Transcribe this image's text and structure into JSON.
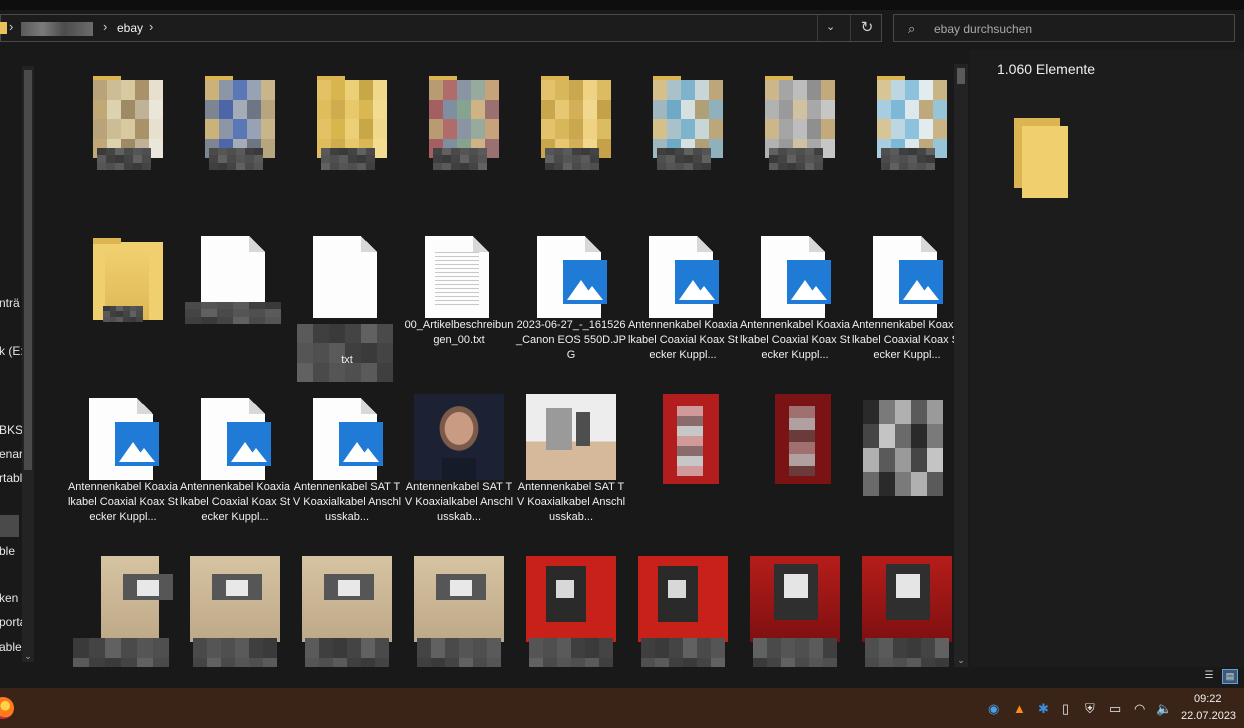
{
  "address": {
    "crumbs": [
      "ebay"
    ],
    "chevron": "›",
    "dropdown": "⌄",
    "refresh": "↻"
  },
  "search": {
    "placeholder": "ebay durchsuchen"
  },
  "nav": {
    "items": [
      "nträ",
      "k (E:",
      "BKS",
      "enar",
      "rtabl",
      "ble",
      "ken",
      "porta",
      "able"
    ],
    "scroll_down": "⌄"
  },
  "files": [
    {
      "type": "folder-blur",
      "palette": [
        "#b9a37a",
        "#cdbd94",
        "#d9c9a0",
        "#a9926a",
        "#e7e0cf",
        "#c2a777",
        "#ddd2b0",
        "#9f8a66",
        "#bfb296",
        "#ebe6da"
      ]
    },
    {
      "type": "folder-blur",
      "palette": [
        "#cbb27a",
        "#8c96a6",
        "#5a78b6",
        "#97a2b4",
        "#c9b58a",
        "#7d8592",
        "#4c66a8",
        "#a4acb8",
        "#6e7686",
        "#b6a57e"
      ]
    },
    {
      "type": "folder-blur",
      "palette": [
        "#e3c266",
        "#d7b64e",
        "#ecd078",
        "#c8a748",
        "#f0d88a",
        "#dfbd5c",
        "#cfad4e",
        "#e8c86a",
        "#d9b854",
        "#f2dc90"
      ]
    },
    {
      "type": "folder-blur",
      "palette": [
        "#b89a73",
        "#b06b6b",
        "#8a94a2",
        "#97aa9e",
        "#c6a37a",
        "#a46060",
        "#7f8ea0",
        "#86a38f",
        "#d0b384",
        "#9b7070"
      ]
    },
    {
      "type": "folder-blur",
      "palette": [
        "#e2c36c",
        "#d8b65a",
        "#caa850",
        "#efd382",
        "#dcbc62",
        "#c9a64c",
        "#e6c872",
        "#d3b058",
        "#f0d88e",
        "#c5a24a"
      ]
    },
    {
      "type": "folder-blur",
      "palette": [
        "#d5c08a",
        "#a9c2c9",
        "#7fb3cc",
        "#c8d6d8",
        "#bba77a",
        "#9fb8c0",
        "#6ea9c8",
        "#d7e0e0",
        "#b0a078",
        "#8fb0bd"
      ]
    },
    {
      "type": "folder-blur",
      "palette": [
        "#cdb68a",
        "#a5a5a5",
        "#bdbdbd",
        "#8f8f8f",
        "#c3aa7a",
        "#b2b2b2",
        "#9a9a9a",
        "#d0c2a0",
        "#a8a8a8",
        "#c6c6c6"
      ]
    },
    {
      "type": "folder-blur",
      "palette": [
        "#d8c596",
        "#bcd6e2",
        "#8cc2dc",
        "#e2ecef",
        "#c9b486",
        "#a8cde0",
        "#7db8d6",
        "#dde8ec",
        "#bfa97c",
        "#98c4d8"
      ]
    },
    {
      "type": "folder-plain"
    },
    {
      "type": "doc-blank"
    },
    {
      "type": "doc-blank",
      "tail": "txt"
    },
    {
      "type": "txt",
      "name": "00_Artikelbeschreibungen_00.txt"
    },
    {
      "type": "image",
      "name": "2023-06-27_-_161526_Canon EOS 550D.JPG"
    },
    {
      "type": "image",
      "name": "Antennenkabel Koaxialkabel Coaxial Koax Stecker Kuppl..."
    },
    {
      "type": "image",
      "name": "Antennenkabel Koaxialkabel Coaxial Koax Stecker Kuppl..."
    },
    {
      "type": "image",
      "name": "Antennenkabel Koaxialkabel Coaxial Koax Stecker Kuppl..."
    },
    {
      "type": "image",
      "name": "Antennenkabel Koaxialkabel Coaxial Koax Stecker Kuppl..."
    },
    {
      "type": "image",
      "name": "Antennenkabel Koaxialkabel Coaxial Koax Stecker Kuppl..."
    },
    {
      "type": "image",
      "name": "Antennenkabel SAT TV Koaxialkabel Anschlusskab..."
    },
    {
      "type": "photo-face",
      "name": "Antennenkabel SAT TV Koaxialkabel Anschlusskab..."
    },
    {
      "type": "photo-kitchen",
      "name": "Antennenkabel SAT TV Koaxialkabel Anschlusskab..."
    },
    {
      "type": "photo-redblur"
    },
    {
      "type": "photo-darkred"
    },
    {
      "type": "photo-grayblur"
    },
    {
      "type": "watch-beige-tall"
    },
    {
      "type": "watch-beige"
    },
    {
      "type": "watch-beige"
    },
    {
      "type": "watch-beige"
    },
    {
      "type": "watch-red"
    },
    {
      "type": "watch-red"
    },
    {
      "type": "watch-black-red"
    },
    {
      "type": "watch-black-red"
    }
  ],
  "details": {
    "count": "1.060 Elemente"
  },
  "statusbar": {
    "list_icon": "☰",
    "tiles_icon": "▤"
  },
  "taskbar": {
    "tray": [
      "◉",
      "▲",
      "✱",
      "▯",
      "⛨",
      "▭",
      "◠",
      "🔈"
    ],
    "time": "09:22",
    "date": "22.07.2023"
  }
}
